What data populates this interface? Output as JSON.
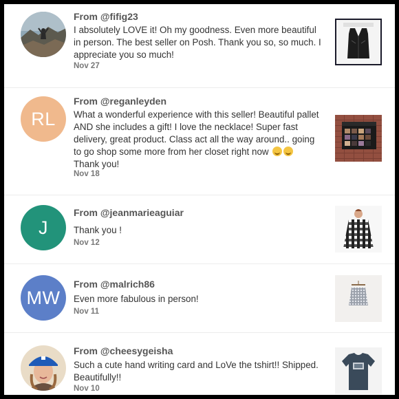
{
  "reviews": [
    {
      "from": "From @fifig23",
      "message": "I absolutely LOVE it! Oh my goodness. Even more beautiful in person. The best seller on Posh. Thank you so, so much. I appreciate you so much!",
      "date": "Nov 27",
      "avatar": {
        "type": "photo",
        "icon": "mountain-photo-avatar"
      },
      "thumbnail": "black-leather-vest-image"
    },
    {
      "from": "From @reganleyden",
      "message": "What a wonderful experience with this seller! Beautiful pallet AND she includes a gift! I love the necklace! Super fast delivery, great product. Class act all the way around.. going to go shop some more from her closet right now",
      "message_end": "Thank you!",
      "date": "Nov 18",
      "avatar": {
        "type": "initials",
        "initials": "RL",
        "color": "#f0b98d"
      },
      "thumbnail": "eyeshadow-palette-image"
    },
    {
      "from": "From @jeanmarieaguiar",
      "message": "Thank you !",
      "date": "Nov 12",
      "avatar": {
        "type": "initials",
        "initials": "J",
        "color": "#22937a"
      },
      "thumbnail": "plaid-shirt-image"
    },
    {
      "from": "From @malrich86",
      "message": "Even more fabulous in person!",
      "date": "Nov 11",
      "avatar": {
        "type": "initials",
        "initials": "MW",
        "color": "#5c7fc8"
      },
      "thumbnail": "sequin-skirt-image"
    },
    {
      "from": "From @cheesygeisha",
      "message": "Such a cute hand writing card and LoVe the tshirt!! Shipped. Beautifully!!",
      "date": "Nov 10",
      "avatar": {
        "type": "photo",
        "icon": "person-blue-cap-avatar"
      },
      "thumbnail": "graphic-tshirt-image"
    }
  ]
}
